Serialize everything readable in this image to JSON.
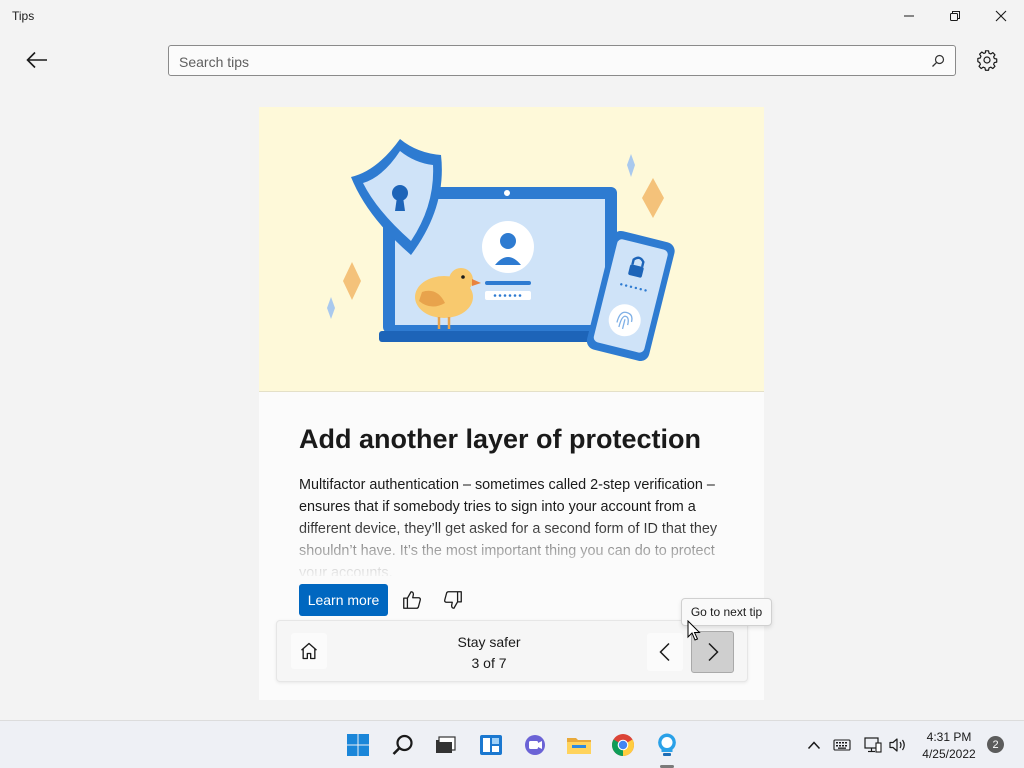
{
  "window": {
    "title": "Tips",
    "minimize_icon": "minimize-icon",
    "restore_icon": "restore-icon",
    "close_icon": "close-icon"
  },
  "header": {
    "back_icon": "back-arrow-icon",
    "search_placeholder": "Search tips",
    "search_icon": "search-icon",
    "settings_icon": "gear-icon"
  },
  "tip": {
    "title": "Add another layer of protection",
    "body": "Multifactor authentication – sometimes called 2-step verification – ensures that if somebody tries to sign into your account from a different device, they’ll get asked for a second form of ID that they shouldn’t have. It’s the most important thing you can do to protect your accounts.",
    "learn_more_label": "Learn more",
    "like_icon": "thumbs-up-icon",
    "dislike_icon": "thumbs-down-icon"
  },
  "nav": {
    "collection_title": "Stay safer",
    "position": "3 of 7",
    "home_icon": "home-icon",
    "prev_icon": "chevron-left-icon",
    "next_icon": "chevron-right-icon",
    "next_tooltip": "Go to next tip"
  },
  "taskbar": {
    "apps": [
      "start",
      "search",
      "task-view",
      "widgets",
      "chat",
      "file-explorer",
      "chrome",
      "tips"
    ],
    "active_app": "tips",
    "clock_time": "4:31 PM",
    "clock_date": "4/25/2022",
    "notification_count": "2"
  },
  "colors": {
    "accent": "#0067c0",
    "hero_background": "#fef9d9"
  }
}
